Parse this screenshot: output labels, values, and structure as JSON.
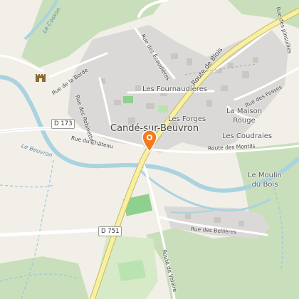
{
  "colors": {
    "background": "#f2efe9",
    "forest": "#c9dfbb",
    "built": "#dbd9d7",
    "water": "#aad3df",
    "primary_road": "#f7f0a0",
    "marker": "#f47a20"
  },
  "places": {
    "town": "Candé-sur-Beuvron",
    "fournaudieres": "Les Fournaudières",
    "forges": "Les Forges",
    "maison_rouge": "La Maison Rouge",
    "coudraies": "Les Coudraies",
    "moulin_du_bois": "Le Moulin du Bois"
  },
  "roads": {
    "d173": "D 173",
    "d751": "D 751",
    "rue_de_la_borde": "Rue de la Borde",
    "rue_des_robinettes": "Rue des Robinettes",
    "rue_des_ecaudieres": "Rue des Écaudières",
    "route_de_blois": "Route de Blois",
    "rue_des_pinsuilles": "Rue des pinsuilles",
    "rue_des_fosses": "Rue des Fosses",
    "rue_du_chateau": "Rue du Château",
    "route_des_montils": "Route des Montils",
    "rue_des_bellieres": "Rue des Bellières",
    "route_de_valaire": "Route de Valaire"
  },
  "waterways": {
    "le_cosson": "Le Cosson",
    "le_beuvron": "Le Beuvron"
  },
  "icons": {
    "castle": "castle-icon",
    "marker": "location-pin-icon"
  }
}
